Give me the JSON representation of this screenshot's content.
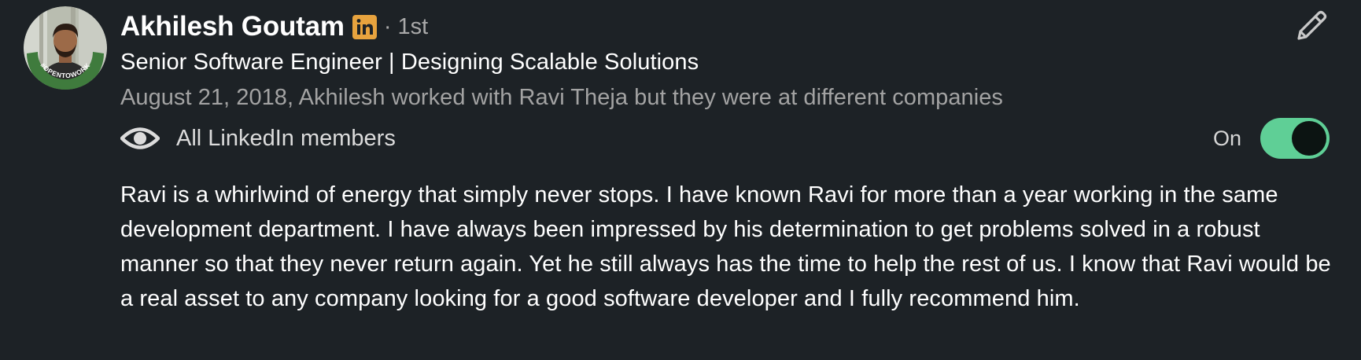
{
  "recommender": {
    "name": "Akhilesh Goutam",
    "degree": "· 1st",
    "headline": "Senior Software Engineer | Designing Scalable Solutions",
    "relationship": "August 21, 2018, Akhilesh worked with Ravi Theja but they were at different companies",
    "avatar_frame_text": "#OPENTOWORK"
  },
  "visibility": {
    "label": "All LinkedIn members",
    "toggle_state": "On",
    "toggle_on": true
  },
  "recommendation_text": "Ravi is a whirlwind of energy that simply never stops. I have known Ravi for more than a year working in the same development department. I have always been impressed by his determination to get problems solved in a robust manner so that they never return again. Yet he still always has the time to help the rest of us. I know that Ravi would be a real asset to any company looking for a good software developer and I fully recommend him.",
  "colors": {
    "background": "#1d2226",
    "toggle_track": "#5fcf96",
    "premium_badge": "#e7a33e",
    "open_to_work_ring": "#3f7b3d"
  },
  "icons": {
    "premium": "linkedin-premium-icon",
    "visibility": "eye-icon",
    "edit": "pencil-icon"
  }
}
